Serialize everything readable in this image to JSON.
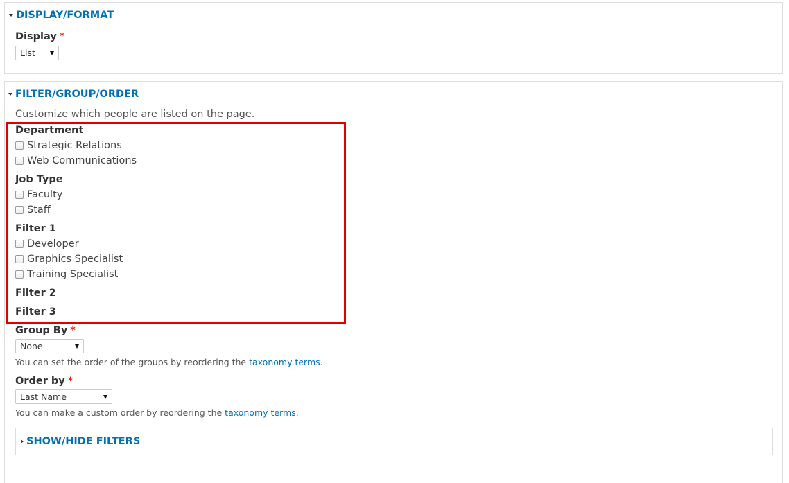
{
  "display_format": {
    "legend": "DISPLAY/FORMAT",
    "display_label": "Display",
    "required_mark": "*",
    "display_value": "List"
  },
  "filter_group_order": {
    "legend": "FILTER/GROUP/ORDER",
    "description": "Customize which people are listed on the page.",
    "department": {
      "label": "Department",
      "options": [
        "Strategic Relations",
        "Web Communications"
      ]
    },
    "job_type": {
      "label": "Job Type",
      "options": [
        "Faculty",
        "Staff"
      ]
    },
    "filter1": {
      "label": "Filter 1",
      "options": [
        "Developer",
        "Graphics Specialist",
        "Training Specialist"
      ]
    },
    "filter2": {
      "label": "Filter 2"
    },
    "filter3": {
      "label": "Filter 3"
    },
    "group_by": {
      "label": "Group By",
      "required_mark": "*",
      "value": "None",
      "help_prefix": "You can set the order of the groups by reordering the ",
      "help_link": "taxonomy terms",
      "help_suffix": "."
    },
    "order_by": {
      "label": "Order by",
      "required_mark": "*",
      "value": "Last Name",
      "help_prefix": "You can make a custom order by reordering the ",
      "help_link": "taxonomy terms",
      "help_suffix": "."
    },
    "show_hide": {
      "legend": "SHOW/HIDE FILTERS"
    }
  },
  "colors": {
    "link": "#0071b3",
    "required": "#e32700",
    "highlight": "#e00000",
    "border": "#dddddd"
  }
}
